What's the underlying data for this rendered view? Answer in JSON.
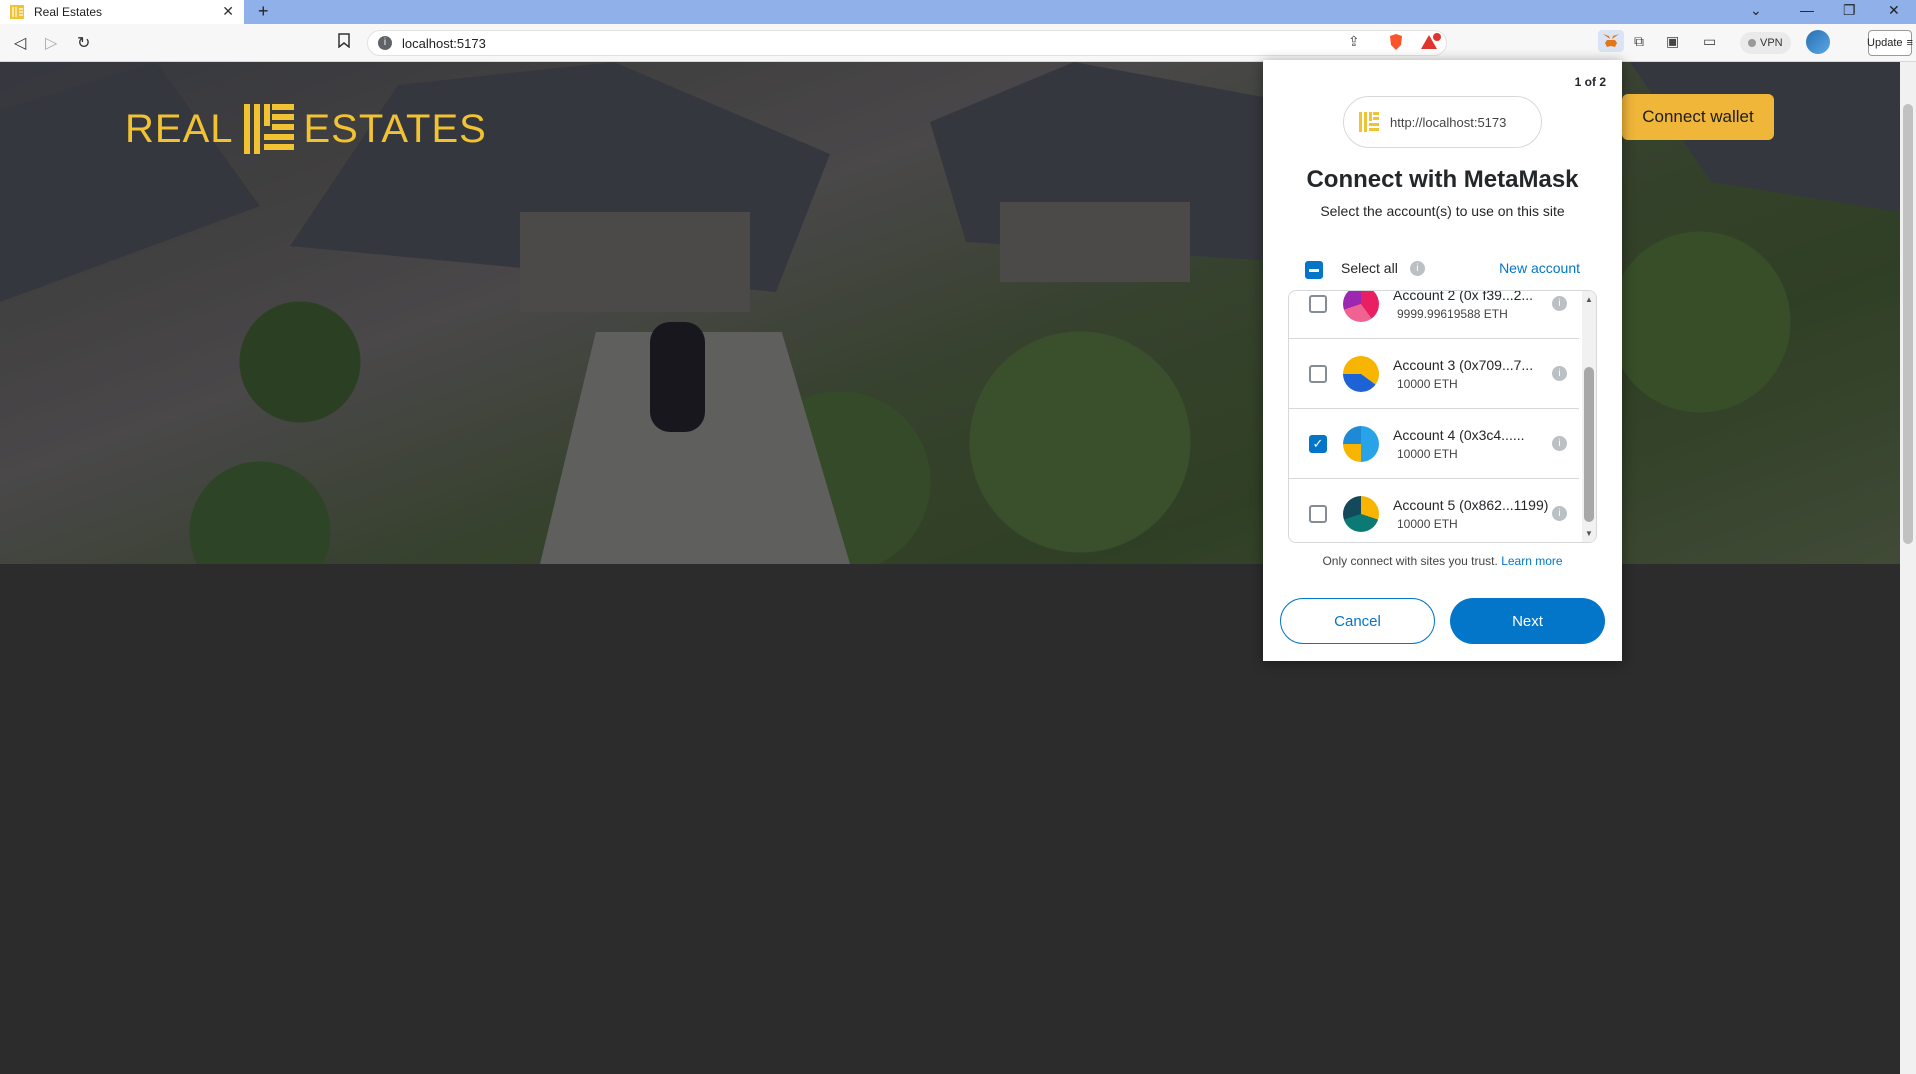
{
  "browser": {
    "tab_title": "Real Estates",
    "url": "localhost:5173",
    "vpn_label": "VPN",
    "update_label": "Update",
    "icons": [
      "back-icon",
      "forward-icon",
      "reload-icon",
      "bookmark-icon",
      "share-icon",
      "brave-icon",
      "rewards-icon",
      "metamask-icon",
      "extensions-icon",
      "sidebar-icon",
      "wallet-icon",
      "profile-icon",
      "menu-icon"
    ]
  },
  "site": {
    "logo_left": "REAL",
    "logo_right": "ESTATES",
    "connect_wallet_label": "Connect wallet",
    "brand_color": "#f1c232"
  },
  "metamask": {
    "pager": "1 of 2",
    "origin": "http://localhost:5173",
    "title": "Connect with MetaMask",
    "subtitle": "Select the account(s) to use on this site",
    "select_all_label": "Select all",
    "new_account_label": "New account",
    "accounts": [
      {
        "name": "Account 2 (0x f39...2...",
        "balance": "9999.99619588 ETH",
        "checked": false
      },
      {
        "name": "Account 3 (0x709...7...",
        "balance": "10000 ETH",
        "checked": false
      },
      {
        "name": "Account 4 (0x3c4......",
        "balance": "10000 ETH",
        "checked": true
      },
      {
        "name": "Account 5 (0x862...1199)",
        "balance": "10000 ETH",
        "checked": false
      }
    ],
    "trust_text": "Only connect with sites you trust.",
    "learn_more_label": "Learn more",
    "cancel_label": "Cancel",
    "next_label": "Next",
    "accent_color": "#0376c9"
  }
}
